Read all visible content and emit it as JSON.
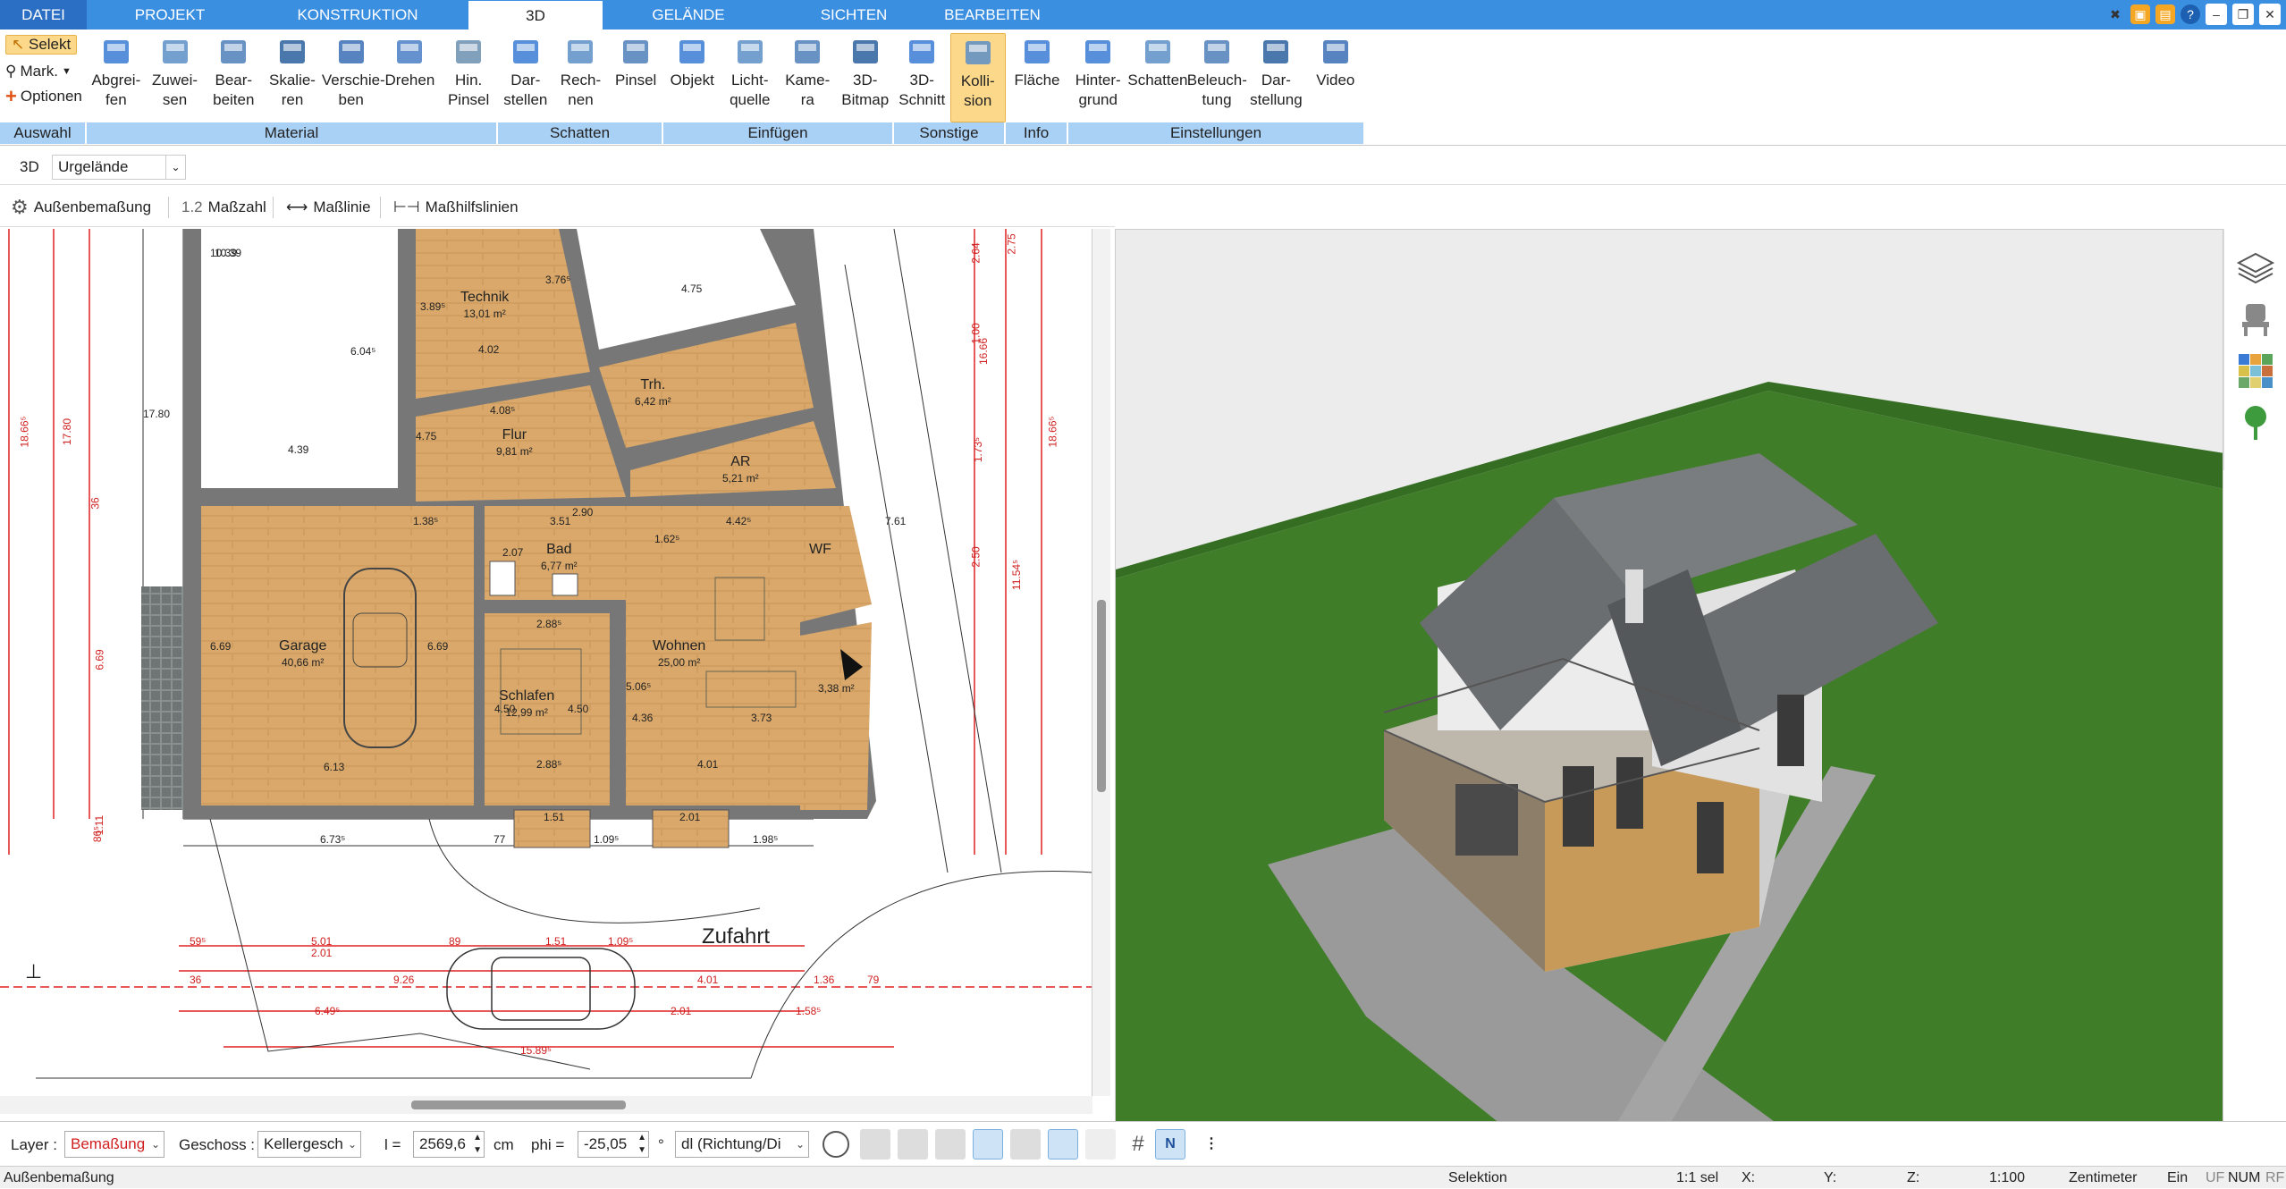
{
  "tabs": [
    "DATEI",
    "PROJEKT",
    "KONSTRUKTION",
    "3D",
    "GELÄNDE",
    "SICHTEN",
    "BEARBEITEN"
  ],
  "ribbon": {
    "auswahl": {
      "selekt": "Selekt",
      "mark": "Mark.",
      "optionen": "Optionen",
      "label": "Auswahl"
    },
    "material": {
      "label": "Material",
      "buttons": [
        [
          "Abgrei-",
          "fen"
        ],
        [
          "Zuwei-",
          "sen"
        ],
        [
          "Bear-",
          "beiten"
        ],
        [
          "Skalie-",
          "ren"
        ],
        [
          "Verschie-",
          "ben"
        ],
        [
          "Drehen",
          ""
        ],
        [
          "Hin.",
          "Pinsel"
        ]
      ]
    },
    "schatten": {
      "label": "Schatten",
      "buttons": [
        [
          "Dar-",
          "stellen"
        ],
        [
          "Rech-",
          "nen"
        ],
        [
          "Pinsel",
          ""
        ]
      ]
    },
    "einfuegen": {
      "label": "Einfügen",
      "buttons": [
        [
          "Objekt",
          ""
        ],
        [
          "Licht-",
          "quelle"
        ],
        [
          "Kame-",
          "ra"
        ],
        [
          "3D-",
          "Bitmap"
        ]
      ]
    },
    "sonstige": {
      "label": "Sonstige",
      "buttons": [
        [
          "3D-",
          "Schnitt"
        ],
        [
          "Kolli-",
          "sion"
        ]
      ]
    },
    "info": {
      "label": "Info",
      "buttons": [
        [
          "Fläche",
          ""
        ]
      ]
    },
    "einstellungen": {
      "label": "Einstellungen",
      "buttons": [
        [
          "Hinter-",
          "grund"
        ],
        [
          "Schatten",
          ""
        ],
        [
          "Beleuch-",
          "tung"
        ],
        [
          "Dar-",
          "stellung"
        ],
        [
          "Video",
          ""
        ]
      ]
    }
  },
  "bar2": {
    "mode": "3D",
    "layer_select": "Urgelände"
  },
  "bar3": {
    "aussen": "Außenbemaßung",
    "masszahl_prefix": "1.2",
    "masszahl": "Maßzahl",
    "masslinie": "Maßlinie",
    "masshilfslinien": "Maßhilfslinien"
  },
  "plan": {
    "rooms": [
      {
        "name": "Technik",
        "area": "13,01 m²"
      },
      {
        "name": "Flur",
        "area": "9,81 m²"
      },
      {
        "name": "Trh.",
        "area": "6,42 m²"
      },
      {
        "name": "AR",
        "area": "5,21 m²"
      },
      {
        "name": "Garage",
        "area": "40,66 m²"
      },
      {
        "name": "Bad",
        "area": "6,77 m²"
      },
      {
        "name": "WF",
        "area": ""
      },
      {
        "name": "Schlafen",
        "area": "12,99 m²"
      },
      {
        "name": "Wohnen",
        "area": "25,00 m²"
      },
      {
        "name": "",
        "area": "3,38 m²"
      }
    ],
    "zufahrt": "Zufahrt",
    "dims": [
      "4.75",
      "4.39",
      "6.04⁵",
      "10.39",
      "17.80",
      "18.66⁵",
      "4.75",
      "4.02",
      "4.08⁵",
      "2.90",
      "3.51",
      "4.42⁵",
      "6.69",
      "6.69",
      "2.88⁵",
      "2.88⁵",
      "4.01",
      "6.13",
      "6.73⁵",
      "77",
      "1.09⁵",
      "1.98⁵",
      "1.51",
      "2.01",
      "5.01",
      "2.01",
      "9.26",
      "6.49⁵",
      "15.89⁵",
      "4.01",
      "1.36",
      "79",
      "1.51",
      "1.09⁵",
      "89",
      "2.01",
      "1.58⁵",
      "4.36",
      "7.61",
      "3.89⁵",
      "3.76⁵",
      "1.38⁵",
      "1.62⁵",
      "5.06⁵",
      "3.73",
      "4.50",
      "4.50",
      "2.64",
      "2.75",
      "1.00",
      "1.73⁵",
      "2.50",
      "11.54⁵",
      "18.66⁵",
      "16.66",
      "86⁵",
      "1.11",
      "36",
      "6.69",
      "17.80",
      "10.39",
      "59⁵",
      "36",
      "2.07"
    ]
  },
  "bottom": {
    "layer_label": "Layer :",
    "layer_value": "Bemaßung",
    "geschoss_label": "Geschoss :",
    "geschoss_value": "Kellergesch",
    "l_label": "l =",
    "l_value": "2569,6",
    "l_unit": "cm",
    "phi_label": "phi =",
    "phi_value": "-25,05",
    "phi_unit": "°",
    "dl_value": "dl (Richtung/Di"
  },
  "status": {
    "left": "Außenbemaßung",
    "mode": "Selektion",
    "ratio": "1:1 sel",
    "x": "X:",
    "y": "Y:",
    "z": "Z:",
    "scale": "1:100",
    "unit": "Zentimeter",
    "ein": "Ein",
    "uf": "UF",
    "num": "NUM",
    "rf": "RF"
  },
  "colors": {
    "tabbar": "#3b8fe0",
    "ribbon_group": "#a9d0f5",
    "floor": "#d8a56a",
    "grass": "#3f7d29",
    "dim": "#e02020"
  }
}
